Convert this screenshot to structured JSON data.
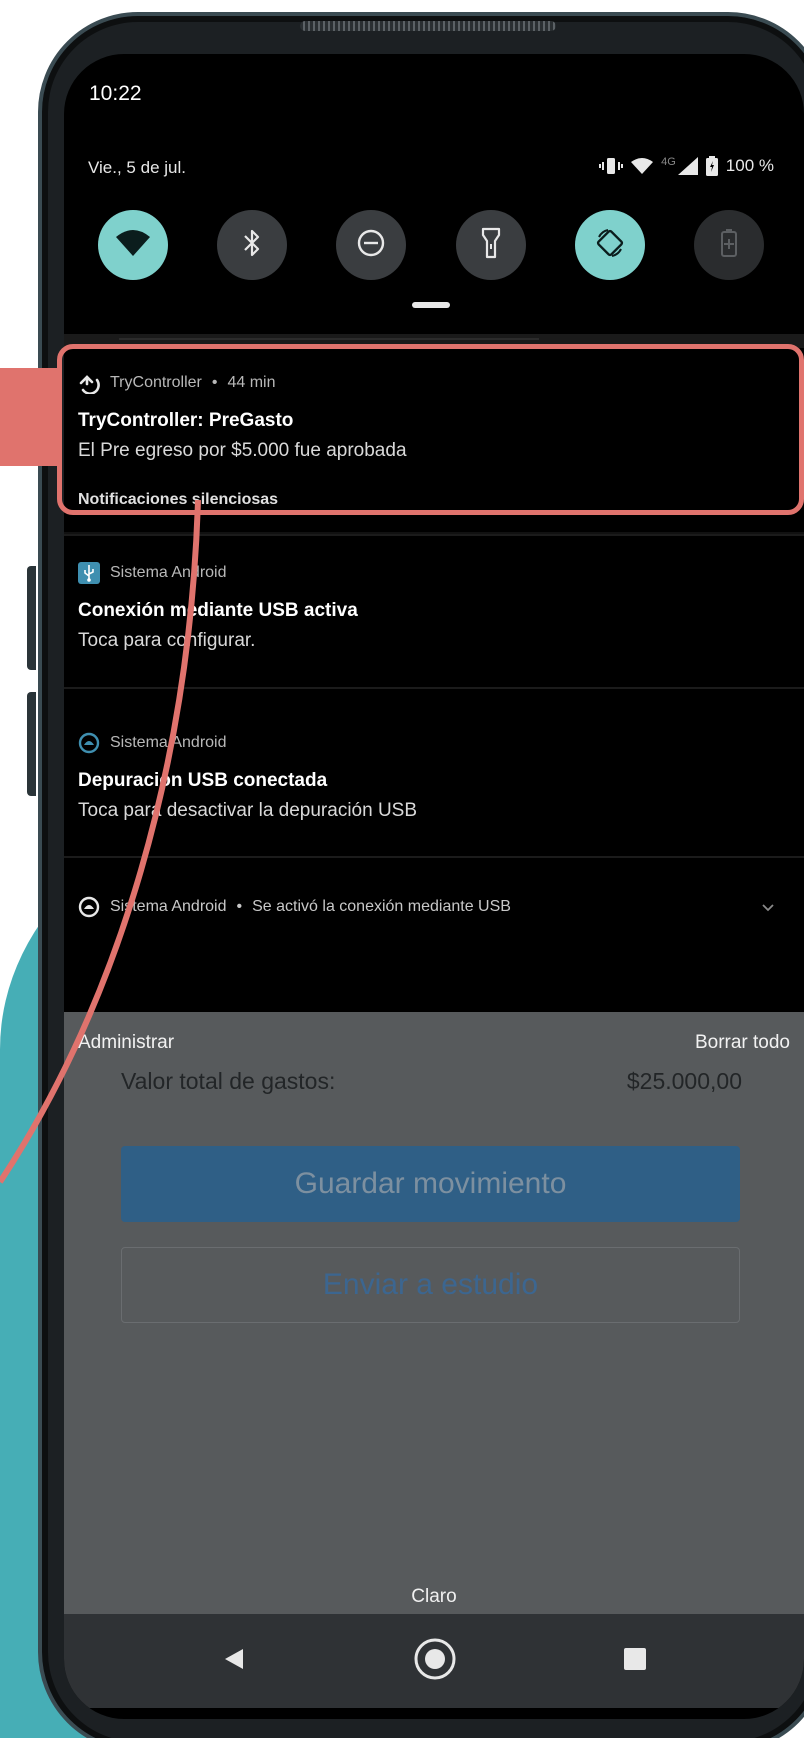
{
  "status": {
    "time": "10:22",
    "date": "Vie., 5 de jul.",
    "network": "4G",
    "battery": "100 %"
  },
  "quick_settings": [
    {
      "icon": "wifi-icon",
      "active": true
    },
    {
      "icon": "bluetooth-icon",
      "active": false
    },
    {
      "icon": "do-not-disturb-icon",
      "active": false
    },
    {
      "icon": "flashlight-icon",
      "active": false
    },
    {
      "icon": "auto-rotate-icon",
      "active": true
    },
    {
      "icon": "battery-saver-icon",
      "active": false
    }
  ],
  "notifications": {
    "primary": {
      "app": "TryController",
      "time": "44 min",
      "title": "TryController: PreGasto",
      "body": "El Pre egreso por $5.000 fue aprobada"
    },
    "silent_label": "Notificaciones silenciosas",
    "usb": {
      "app": "Sistema Android",
      "title": "Conexión mediante USB activa",
      "body": "Toca para configurar."
    },
    "debug": {
      "app": "Sistema Android",
      "title": "Depuración USB conectada",
      "body": "Toca para desactivar la depuración USB"
    },
    "collapsed": {
      "app": "Sistema Android",
      "summary": "Se activó la conexión mediante USB"
    }
  },
  "shade_actions": {
    "manage": "Administrar",
    "clear_all": "Borrar todo"
  },
  "app_behind": {
    "total_label": "Valor total de gastos:",
    "total_value": "$25.000,00",
    "save_button": "Guardar movimiento",
    "send_button": "Enviar a estudio"
  },
  "carrier": "Claro",
  "colors": {
    "highlight": "#e0736d",
    "teal_background": "#46aeb6",
    "quick_setting_active": "#7fd1cc"
  }
}
